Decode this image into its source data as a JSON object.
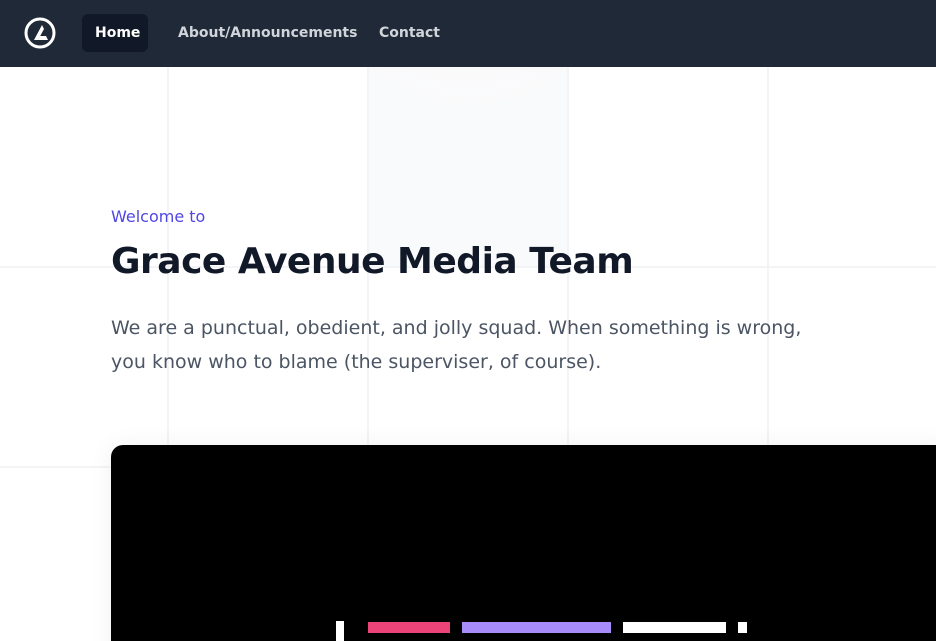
{
  "nav": {
    "logo_icon": "brand-logo-icon",
    "items": [
      {
        "label": "Home",
        "active": true
      },
      {
        "label": "About/Announcements",
        "active": false
      },
      {
        "label": "Contact",
        "active": false
      }
    ]
  },
  "hero": {
    "eyebrow": "Welcome to",
    "title": "Grace Avenue Media Team",
    "description": "We are a punctual, obedient, and jolly squad. When something is wrong, you know who to blame (the superviser, of course)."
  },
  "colors": {
    "nav_bg": "#1f2937",
    "accent": "#4f46e5",
    "bar_pink": "#ec4478",
    "bar_purple": "#a78bfa",
    "bar_white": "#ffffff"
  }
}
